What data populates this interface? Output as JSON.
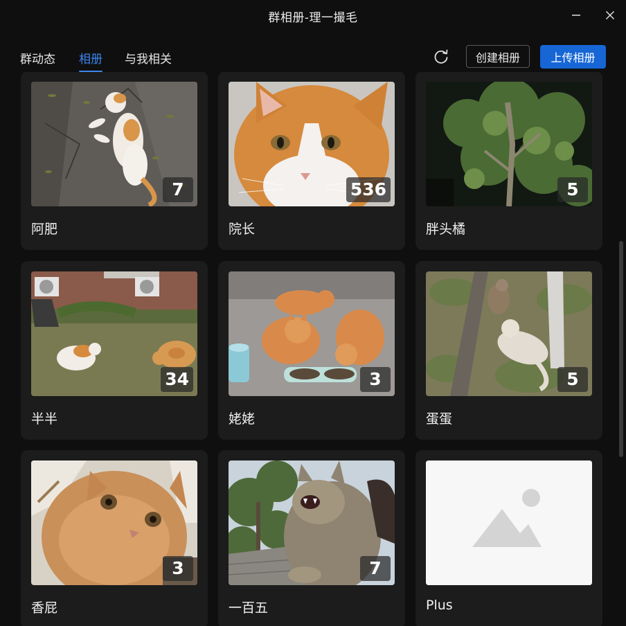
{
  "window": {
    "title": "群相册-理一撮毛",
    "minimize_icon": "minimize-icon",
    "close_icon": "close-icon"
  },
  "nav": {
    "tabs": [
      {
        "label": "群动态",
        "active": false
      },
      {
        "label": "相册",
        "active": true
      },
      {
        "label": "与我相关",
        "active": false
      }
    ],
    "refresh_icon": "refresh-icon",
    "create_label": "创建相册",
    "upload_label": "上传相册",
    "accent_color": "#3d86f0",
    "upload_color": "#1666d6"
  },
  "albums": [
    {
      "name": "阿肥",
      "count": "7",
      "thumb": "cat-lying-on-rock"
    },
    {
      "name": "院长",
      "count": "536",
      "thumb": "orange-white-cat-closeup"
    },
    {
      "name": "胖头橘",
      "count": "5",
      "thumb": "tree-at-night"
    },
    {
      "name": "半半",
      "count": "34",
      "thumb": "cats-in-yard"
    },
    {
      "name": "姥姥",
      "count": "3",
      "thumb": "three-cats-eating"
    },
    {
      "name": "蛋蛋",
      "count": "5",
      "thumb": "cats-by-trees"
    },
    {
      "name": "香屁",
      "count": "3",
      "thumb": "fluffy-kitten-closeup"
    },
    {
      "name": "一百五",
      "count": "7",
      "thumb": "cat-yawning"
    },
    {
      "name": "Plus",
      "count": "",
      "thumb": "placeholder-image"
    }
  ]
}
